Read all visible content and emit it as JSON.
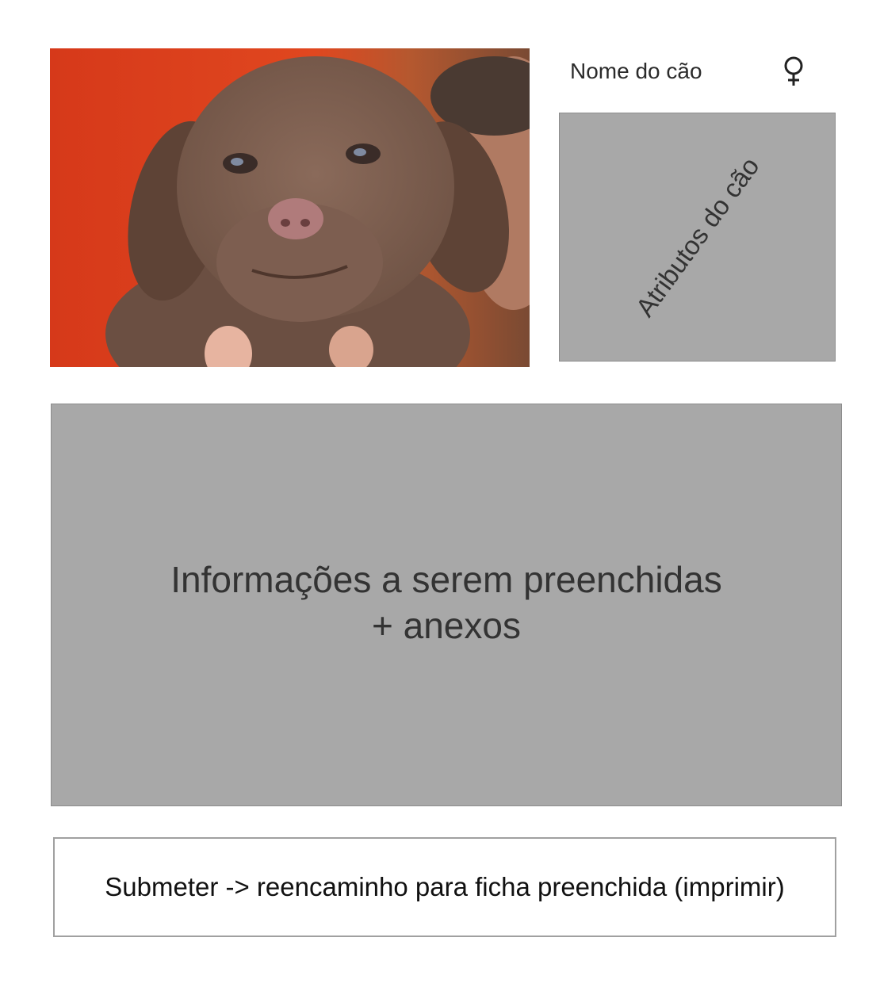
{
  "photo": {
    "subject": "chocolate labrador puppy held in hands"
  },
  "header": {
    "dog_name": "Nome do cão",
    "gender_symbol": "♀"
  },
  "attributes": {
    "label": "Atributos do cão"
  },
  "info": {
    "line1": "Informações a serem preenchidas",
    "line2": "+ anexos"
  },
  "submit": {
    "label": "Submeter -> reencaminho para ficha preenchida (imprimir)"
  },
  "colors": {
    "placeholder_gray": "#a8a8a8",
    "text_dark": "#333333",
    "photo_background": "#d9401c"
  }
}
